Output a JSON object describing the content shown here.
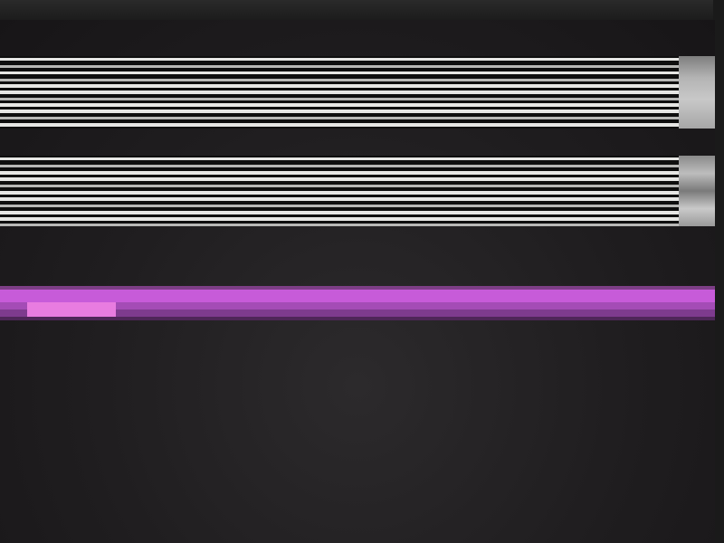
{
  "screen": {
    "state": "display artifact / no readable content",
    "text": []
  }
}
